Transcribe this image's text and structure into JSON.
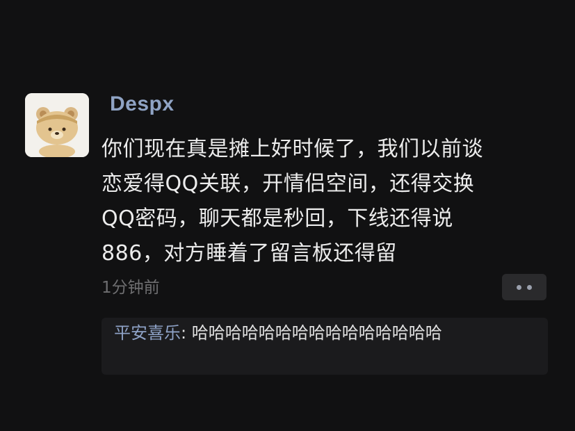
{
  "post": {
    "username": "Despx",
    "avatar_icon": "bear-avatar-icon",
    "content": "你们现在真是摊上好时候了，我们以前谈\n恋爱得QQ关联，开情侣空间，还得交换\nQQ密码，聊天都是秒回，下线还得说\n886，对方睡着了留言板还得留",
    "timestamp": "1分钟前",
    "more_icon": "more-dots-icon"
  },
  "comment": {
    "author": "平安喜乐",
    "separator": ": ",
    "text": "哈哈哈哈哈哈哈哈哈哈哈哈哈哈哈"
  },
  "colors": {
    "background": "#111112",
    "username": "#8fa3c4",
    "timestamp": "#6e6e70",
    "comment_box": "#1b1b1d"
  }
}
